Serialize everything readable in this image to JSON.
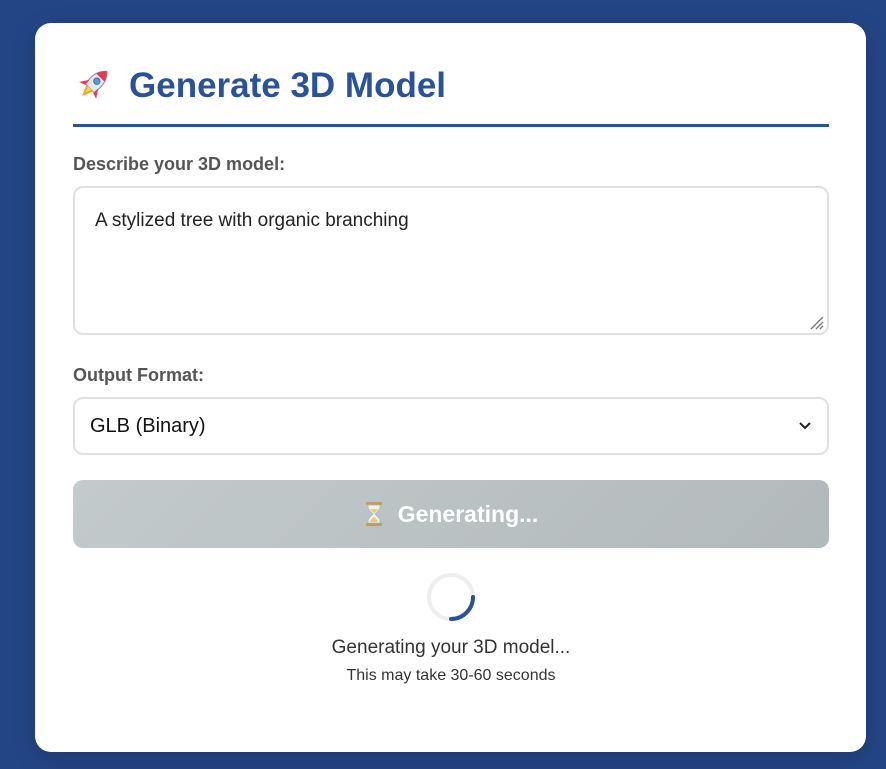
{
  "header": {
    "icon": "rocket-icon",
    "title": "Generate 3D Model"
  },
  "form": {
    "description_label": "Describe your 3D model:",
    "description_value": "A stylized tree with organic branching",
    "format_label": "Output Format:",
    "format_selected": "GLB (Binary)"
  },
  "button": {
    "icon": "hourglass-icon",
    "label": "Generating..."
  },
  "loading": {
    "main_text": "Generating your 3D model...",
    "sub_text": "This may take 30-60 seconds"
  },
  "colors": {
    "page_background": "#244585",
    "accent": "#2a5298",
    "button_disabled": "#b8bfc1"
  }
}
